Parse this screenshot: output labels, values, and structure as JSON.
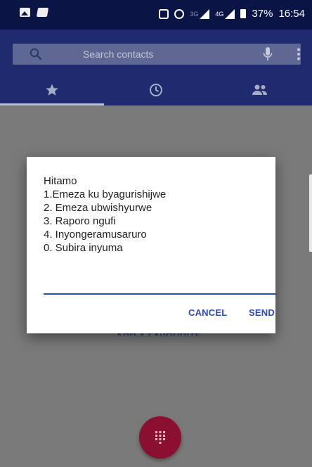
{
  "status_bar": {
    "left_icons": [
      "gallery-icon",
      "flag-icon"
    ],
    "network_tags": [
      "3G",
      "4G"
    ],
    "battery": "37%",
    "time": "16:54"
  },
  "search": {
    "placeholder": "Search contacts"
  },
  "tabs": [
    {
      "icon": "star-icon",
      "active": true
    },
    {
      "icon": "clock-icon",
      "active": false
    },
    {
      "icon": "people-icon",
      "active": false
    }
  ],
  "background": {
    "add_favorite_label": "ADD A FAVOURITE"
  },
  "dialog": {
    "message": "Hitamo\n1.Emeza ku byagurishijwe\n2. Emeza ubwishyurwe\n3. Raporo ngufi\n4. Inyongeramusaruro\n0. Subira inyuma",
    "input_value": "",
    "cancel_label": "CANCEL",
    "send_label": "SEND"
  },
  "colors": {
    "status_bar": "#0a1546",
    "app_bar": "#1f2b6e",
    "accent": "#2f4bb2",
    "fab": "#8a0f30",
    "scrim": "#7a7a7a"
  }
}
